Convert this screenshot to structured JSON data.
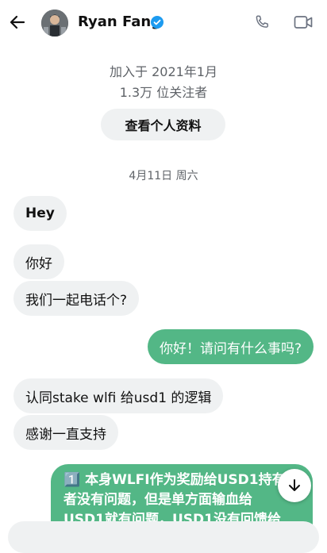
{
  "header": {
    "name": "Ryan Fang"
  },
  "profile": {
    "joined": "加入于 2021年1月",
    "followers": "1.3万 位关注者",
    "view_profile_label": "查看个人资料"
  },
  "chat": {
    "date": "4月11日 周六",
    "messages": [
      {
        "direction": "in",
        "text": "Hey"
      },
      {
        "direction": "in",
        "text": "你好"
      },
      {
        "direction": "in",
        "text": "我们一起电话个?"
      },
      {
        "direction": "out",
        "text": "你好！请问有什么事吗?"
      },
      {
        "direction": "in",
        "text": "认同stake wlfi 给usd1 的逻辑"
      },
      {
        "direction": "in",
        "text": "感谢一直支持"
      }
    ],
    "long_message_lines": [
      "1️⃣ 本身WLFI作为奖励给USD1持有",
      "者没有问题，但是单方面输血给",
      "USD1就有问题，USD1没有回馈给"
    ]
  },
  "colors": {
    "accent_green": "#53b786",
    "incoming_bubble": "#eff1f2",
    "verified_blue": "#1d9bf0"
  },
  "icons": [
    "back-arrow-icon",
    "verified-badge-icon",
    "phone-icon",
    "video-icon",
    "arrow-down-icon"
  ]
}
